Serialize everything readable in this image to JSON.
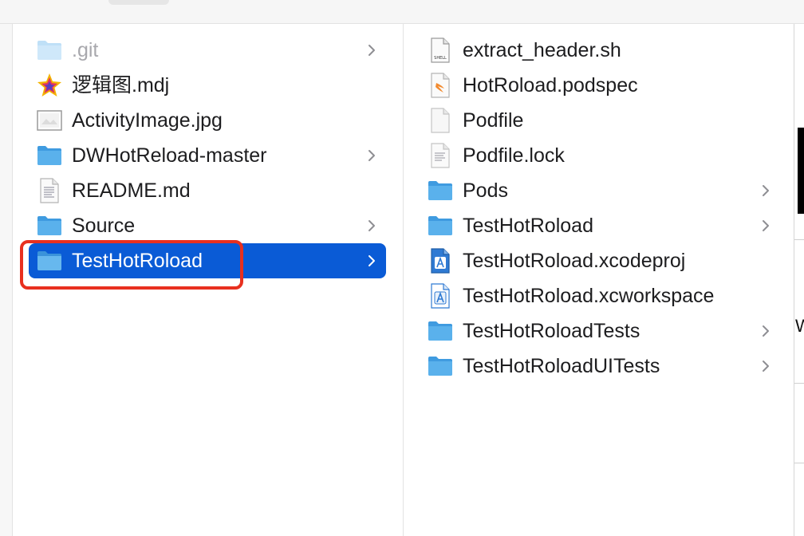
{
  "colors": {
    "selection": "#0a5bd6",
    "folder": "#5ab1ec",
    "annotation": "#e8301f"
  },
  "left_column": {
    "items": [
      {
        "name": ".git",
        "icon": "folder-icon",
        "has_children": true,
        "dimmed": true
      },
      {
        "name": "逻辑图.mdj",
        "icon": "staruml-icon",
        "has_children": false
      },
      {
        "name": "ActivityImage.jpg",
        "icon": "image-file-icon",
        "has_children": false
      },
      {
        "name": "DWHotReload-master",
        "icon": "folder-icon",
        "has_children": true
      },
      {
        "name": "README.md",
        "icon": "text-document-icon",
        "has_children": false
      },
      {
        "name": "Source",
        "icon": "folder-icon",
        "has_children": true
      },
      {
        "name": "TestHotRoload",
        "icon": "folder-icon",
        "has_children": true,
        "selected": true
      }
    ]
  },
  "right_column": {
    "items": [
      {
        "name": "extract_header.sh",
        "icon": "shell-script-icon",
        "has_children": false
      },
      {
        "name": "HotRoload.podspec",
        "icon": "swift-file-icon",
        "has_children": false
      },
      {
        "name": "Podfile",
        "icon": "blank-document-icon",
        "has_children": false
      },
      {
        "name": "Podfile.lock",
        "icon": "text-document-icon",
        "has_children": false
      },
      {
        "name": "Pods",
        "icon": "folder-icon",
        "has_children": true
      },
      {
        "name": "TestHotRoload",
        "icon": "folder-icon",
        "has_children": true
      },
      {
        "name": "TestHotRoload.xcodeproj",
        "icon": "xcode-project-icon",
        "has_children": false
      },
      {
        "name": "TestHotRoload.xcworkspace",
        "icon": "xcode-workspace-icon",
        "has_children": false
      },
      {
        "name": "TestHotRoloadTests",
        "icon": "folder-icon",
        "has_children": true
      },
      {
        "name": "TestHotRoloadUITests",
        "icon": "folder-icon",
        "has_children": true
      }
    ]
  },
  "edge_glyph": "W"
}
